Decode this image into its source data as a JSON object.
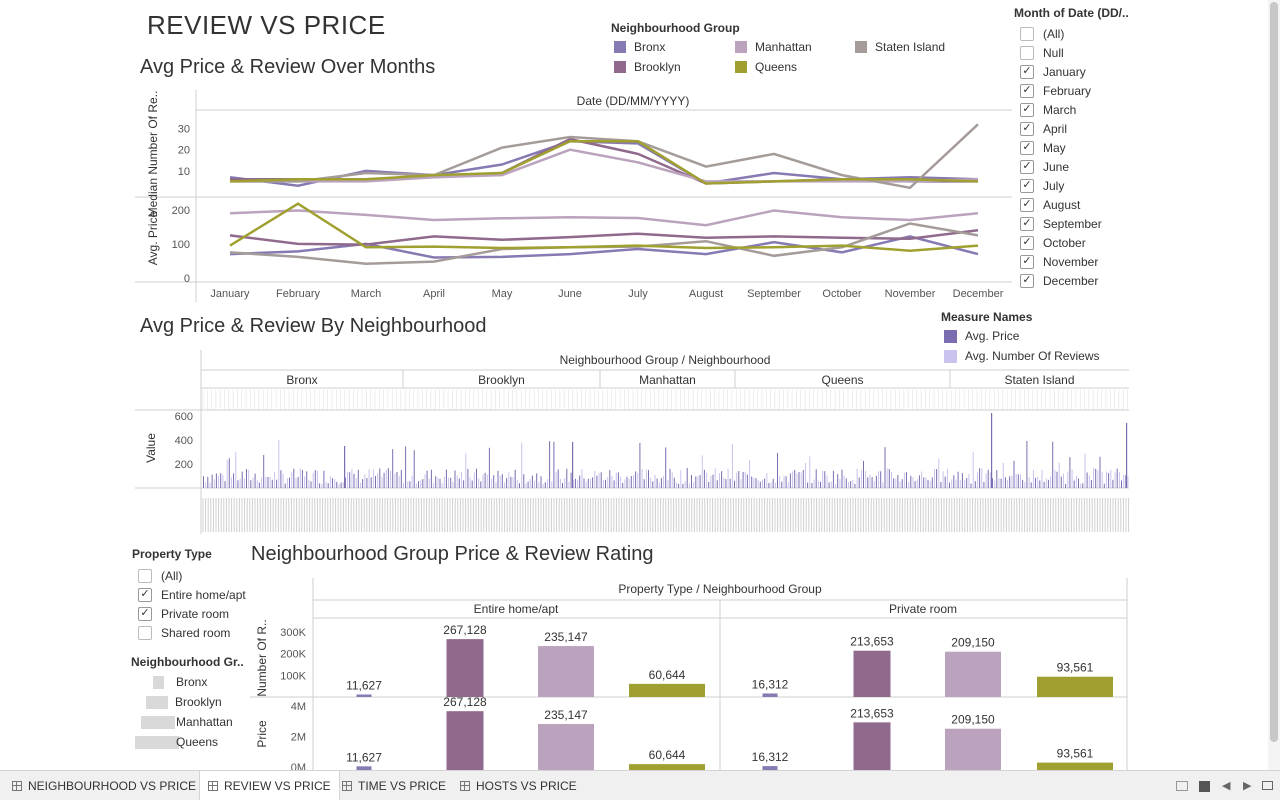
{
  "page": {
    "title": "REVIEW VS PRICE"
  },
  "colors": {
    "bronx": "#8779b2",
    "brooklyn": "#8f6a8c",
    "manhattan": "#bba3bd",
    "staten": "#a59c99",
    "queens": "#a0a030",
    "avg_price": "#7b6db0",
    "avg_reviews": "#c9c3ee"
  },
  "ng_legend": {
    "title": "Neighbourhood Group",
    "items": [
      "Bronx",
      "Manhattan",
      "Staten Island",
      "Brooklyn",
      "Queens"
    ]
  },
  "month_filter": {
    "title": "Month of Date (DD/..",
    "items": [
      {
        "label": "(All)",
        "checked": false
      },
      {
        "label": "Null",
        "checked": false
      },
      {
        "label": "January",
        "checked": true
      },
      {
        "label": "February",
        "checked": true
      },
      {
        "label": "March",
        "checked": true
      },
      {
        "label": "April",
        "checked": true
      },
      {
        "label": "May",
        "checked": true
      },
      {
        "label": "June",
        "checked": true
      },
      {
        "label": "July",
        "checked": true
      },
      {
        "label": "August",
        "checked": true
      },
      {
        "label": "September",
        "checked": true
      },
      {
        "label": "October",
        "checked": true
      },
      {
        "label": "November",
        "checked": true
      },
      {
        "label": "December",
        "checked": true
      }
    ]
  },
  "chart1": {
    "title": "Avg Price & Review Over Months",
    "header": "Date (DD/MM/YYYY)",
    "ylabel_top": "Median Number Of Re..",
    "ylabel_bottom": "Avg. Price",
    "top_ticks": [
      "30",
      "20",
      "10"
    ],
    "bottom_ticks": [
      "200",
      "100",
      "0"
    ]
  },
  "chart_data": [
    {
      "type": "line",
      "title": "Avg Price & Review Over Months",
      "x": [
        "January",
        "February",
        "March",
        "April",
        "May",
        "June",
        "July",
        "August",
        "September",
        "October",
        "November",
        "December"
      ],
      "panels": [
        {
          "ylabel": "Median Number Of Re..",
          "ylim": [
            0,
            35
          ],
          "series": [
            {
              "name": "Bronx",
              "values": [
                7,
                3,
                10,
                8,
                13,
                24,
                23,
                4,
                9,
                6,
                7,
                6
              ]
            },
            {
              "name": "Brooklyn",
              "values": [
                6,
                6,
                6,
                7,
                9,
                25,
                18,
                4,
                5,
                6,
                5,
                5
              ]
            },
            {
              "name": "Manhattan",
              "values": [
                5,
                5,
                5,
                7,
                8,
                20,
                14,
                5,
                5,
                5,
                5,
                6
              ]
            },
            {
              "name": "Staten Island",
              "values": [
                5,
                5,
                9,
                8,
                21,
                26,
                24,
                12,
                18,
                8,
                2,
                32
              ]
            },
            {
              "name": "Queens",
              "values": [
                5,
                6,
                6,
                8,
                9,
                24,
                24,
                4,
                5,
                6,
                6,
                5
              ]
            }
          ]
        },
        {
          "ylabel": "Avg. Price",
          "ylim": [
            0,
            220
          ],
          "series": [
            {
              "name": "Bronx",
              "values": [
                70,
                78,
                100,
                60,
                62,
                70,
                85,
                70,
                105,
                75,
                122,
                70
              ]
            },
            {
              "name": "Brooklyn",
              "values": [
                125,
                100,
                98,
                122,
                112,
                120,
                130,
                118,
                122,
                118,
                115,
                140
              ]
            },
            {
              "name": "Manhattan",
              "values": [
                190,
                198,
                185,
                170,
                175,
                178,
                176,
                155,
                198,
                178,
                170,
                190
              ]
            },
            {
              "name": "Staten Island",
              "values": [
                75,
                62,
                42,
                48,
                85,
                90,
                92,
                108,
                65,
                90,
                160,
                125
              ]
            },
            {
              "name": "Queens",
              "values": [
                95,
                218,
                90,
                92,
                88,
                90,
                95,
                88,
                90,
                95,
                80,
                95
              ]
            }
          ]
        }
      ]
    },
    {
      "type": "bar",
      "title": "Avg Price & Review By Neighbourhood",
      "categories": [
        "Bronx",
        "Brooklyn",
        "Manhattan",
        "Queens",
        "Staten Island"
      ],
      "ylabel": "Value",
      "ylim": [
        0,
        700
      ],
      "series": [
        {
          "name": "Avg. Price",
          "values": []
        },
        {
          "name": "Avg. Number Of Reviews",
          "values": []
        }
      ]
    },
    {
      "type": "bar",
      "title": "Neighbourhood Group Price & Review Rating",
      "categories": [
        "Entire home/apt",
        "Private room"
      ],
      "panels": [
        {
          "ylabel": "Number Of R..",
          "series": [
            {
              "name": "Bronx",
              "values": [
                11627,
                16312
              ]
            },
            {
              "name": "Brooklyn",
              "values": [
                267128,
                213653
              ]
            },
            {
              "name": "Manhattan",
              "values": [
                235147,
                209150
              ]
            },
            {
              "name": "Queens",
              "values": [
                60644,
                93561
              ]
            }
          ]
        },
        {
          "ylabel": "Price",
          "series": [
            {
              "name": "Bronx",
              "values": [
                11627,
                16312
              ]
            },
            {
              "name": "Brooklyn",
              "values": [
                267128,
                213653
              ]
            },
            {
              "name": "Manhattan",
              "values": [
                235147,
                209150
              ]
            },
            {
              "name": "Queens",
              "values": [
                60644,
                93561
              ]
            }
          ]
        }
      ]
    }
  ],
  "chart2": {
    "title": "Avg Price & Review By Neighbourhood",
    "header": "Neighbourhood Group  /  Neighbourhood",
    "groups": [
      "Bronx",
      "Brooklyn",
      "Manhattan",
      "Queens",
      "Staten Island"
    ],
    "ylabel": "Value",
    "ticks": [
      "600",
      "400",
      "200"
    ]
  },
  "measure_legend": {
    "title": "Measure Names",
    "items": [
      "Avg. Price",
      "Avg. Number Of Reviews"
    ]
  },
  "property_filter": {
    "title": "Property Type",
    "items": [
      {
        "label": "(All)",
        "checked": false
      },
      {
        "label": "Entire home/apt",
        "checked": true
      },
      {
        "label": "Private room",
        "checked": true
      },
      {
        "label": "Shared room",
        "checked": false
      }
    ]
  },
  "nh_group_legend": {
    "title": "Neighbourhood Gr..",
    "items": [
      "Bronx",
      "Brooklyn",
      "Manhattan",
      "Queens"
    ]
  },
  "chart3": {
    "title": "Neighbourhood Group Price & Review Rating",
    "header": "Property Type  /  Neighbourhood Group",
    "col1": "Entire home/apt",
    "col2": "Private room",
    "ylabel_top": "Number Of R..",
    "ylabel_bottom": "Price",
    "top_ticks": [
      "300K",
      "200K",
      "100K"
    ],
    "bottom_ticks": [
      "4M",
      "2M",
      "0M"
    ],
    "labels": [
      "11,627",
      "267,128",
      "235,147",
      "60,644",
      "16,312",
      "213,653",
      "209,150",
      "93,561"
    ]
  },
  "tabs": [
    "NEIGHBOURHOOD VS PRICE",
    "REVIEW VS PRICE",
    "TIME VS PRICE",
    "HOSTS VS PRICE"
  ]
}
